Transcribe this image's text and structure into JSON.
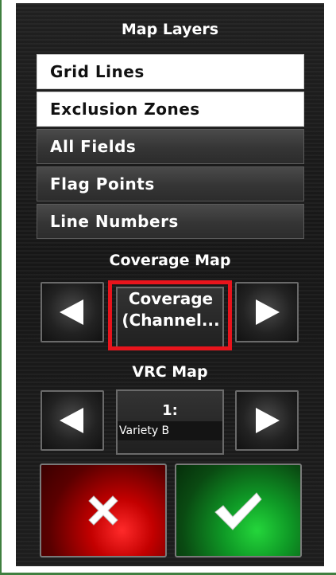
{
  "panel": {
    "title": "Map Layers",
    "layers": [
      {
        "label": "Grid Lines",
        "state": "on"
      },
      {
        "label": "Exclusion Zones",
        "state": "on"
      },
      {
        "label": "All Fields",
        "state": "off"
      },
      {
        "label": "Flag Points",
        "state": "off"
      },
      {
        "label": "Line Numbers",
        "state": "off"
      }
    ]
  },
  "coverage": {
    "heading": "Coverage Map",
    "value_line1": "Coverage",
    "value_line2": "(Channel..."
  },
  "vrc": {
    "heading": "VRC Map",
    "number": "1:",
    "name": "Variety B"
  },
  "colors": {
    "highlight": "#e8141c",
    "cancel": "#c30000",
    "confirm": "#0f9a26"
  },
  "icons": {
    "prev": "left-arrow-icon",
    "next": "right-arrow-icon",
    "cancel": "x-icon",
    "confirm": "checkmark-icon"
  }
}
